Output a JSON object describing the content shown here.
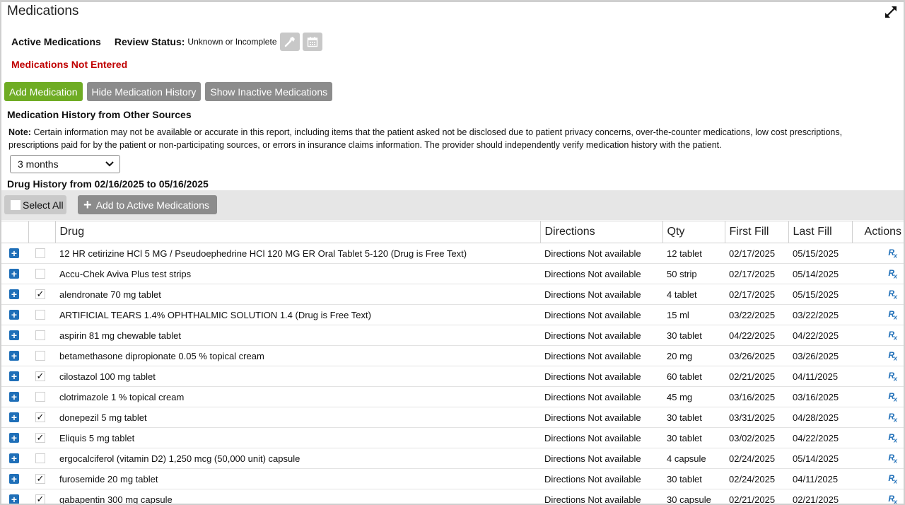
{
  "panel": {
    "title": "Medications"
  },
  "active": {
    "label": "Active Medications",
    "review_label": "Review Status:",
    "review_value": "Unknown or Incomplete",
    "not_entered": "Medications Not Entered"
  },
  "buttons": {
    "add_medication": "Add Medication",
    "hide_history": "Hide Medication History",
    "show_inactive": "Show Inactive Medications"
  },
  "history": {
    "title": "Medication History from Other Sources",
    "note_label": "Note:",
    "note_text": "Certain information may not be available or accurate in this report, including items that the patient asked not be disclosed due to patient privacy concerns, over-the-counter medications, low cost prescriptions, prescriptions paid for by the patient or non-participating sources, or errors in insurance claims information. The provider should independently verify medication history with the patient.",
    "range_selected": "3 months",
    "drug_history_title": "Drug History from 02/16/2025 to 05/16/2025"
  },
  "toolbar": {
    "select_all": "Select All",
    "add_to_active": "Add to Active Medications"
  },
  "table": {
    "headers": [
      "Drug",
      "Directions",
      "Qty",
      "First Fill",
      "Last Fill",
      "Actions"
    ],
    "rows": [
      {
        "checked": false,
        "drug": "12 HR cetirizine HCl 5 MG / Pseudoephedrine HCl 120 MG ER Oral Tablet 5-120 (Drug is Free Text)",
        "directions": "Directions Not available",
        "qty": "12 tablet",
        "first_fill": "02/17/2025",
        "last_fill": "05/15/2025"
      },
      {
        "checked": false,
        "drug": "Accu-Chek Aviva Plus test strips",
        "directions": "Directions Not available",
        "qty": "50 strip",
        "first_fill": "02/17/2025",
        "last_fill": "05/14/2025"
      },
      {
        "checked": true,
        "drug": "alendronate 70 mg tablet",
        "directions": "Directions Not available",
        "qty": "4 tablet",
        "first_fill": "02/17/2025",
        "last_fill": "05/15/2025"
      },
      {
        "checked": false,
        "drug": "ARTIFICIAL TEARS 1.4% OPHTHALMIC SOLUTION 1.4 (Drug is Free Text)",
        "directions": "Directions Not available",
        "qty": "15 ml",
        "first_fill": "03/22/2025",
        "last_fill": "03/22/2025"
      },
      {
        "checked": false,
        "drug": "aspirin 81 mg chewable tablet",
        "directions": "Directions Not available",
        "qty": "30 tablet",
        "first_fill": "04/22/2025",
        "last_fill": "04/22/2025"
      },
      {
        "checked": false,
        "drug": "betamethasone dipropionate 0.05 % topical cream",
        "directions": "Directions Not available",
        "qty": "20 mg",
        "first_fill": "03/26/2025",
        "last_fill": "03/26/2025"
      },
      {
        "checked": true,
        "drug": "cilostazol 100 mg tablet",
        "directions": "Directions Not available",
        "qty": "60 tablet",
        "first_fill": "02/21/2025",
        "last_fill": "04/11/2025"
      },
      {
        "checked": false,
        "drug": "clotrimazole 1 % topical cream",
        "directions": "Directions Not available",
        "qty": "45 mg",
        "first_fill": "03/16/2025",
        "last_fill": "03/16/2025"
      },
      {
        "checked": true,
        "drug": "donepezil 5 mg tablet",
        "directions": "Directions Not available",
        "qty": "30 tablet",
        "first_fill": "03/31/2025",
        "last_fill": "04/28/2025"
      },
      {
        "checked": true,
        "drug": "Eliquis 5 mg tablet",
        "directions": "Directions Not available",
        "qty": "30 tablet",
        "first_fill": "03/02/2025",
        "last_fill": "04/22/2025"
      },
      {
        "checked": false,
        "drug": "ergocalciferol (vitamin D2) 1,250 mcg (50,000 unit) capsule",
        "directions": "Directions Not available",
        "qty": "4 capsule",
        "first_fill": "02/24/2025",
        "last_fill": "05/14/2025"
      },
      {
        "checked": true,
        "drug": "furosemide 20 mg tablet",
        "directions": "Directions Not available",
        "qty": "30 tablet",
        "first_fill": "02/24/2025",
        "last_fill": "04/11/2025"
      },
      {
        "checked": true,
        "drug": "gabapentin 300 mg capsule",
        "directions": "Directions Not available",
        "qty": "30 capsule",
        "first_fill": "02/21/2025",
        "last_fill": "02/21/2025"
      }
    ]
  },
  "icons": {
    "expand": "expand-arrows-icon",
    "review": "hammer-icon",
    "calendar": "calendar-icon",
    "row_expand": "plus-box-icon",
    "action": "rx-icon"
  },
  "colors": {
    "accent_green": "#6fac24",
    "button_gray": "#8c8c8c",
    "alert_red": "#c00000",
    "link_blue": "#1f6fb8"
  }
}
